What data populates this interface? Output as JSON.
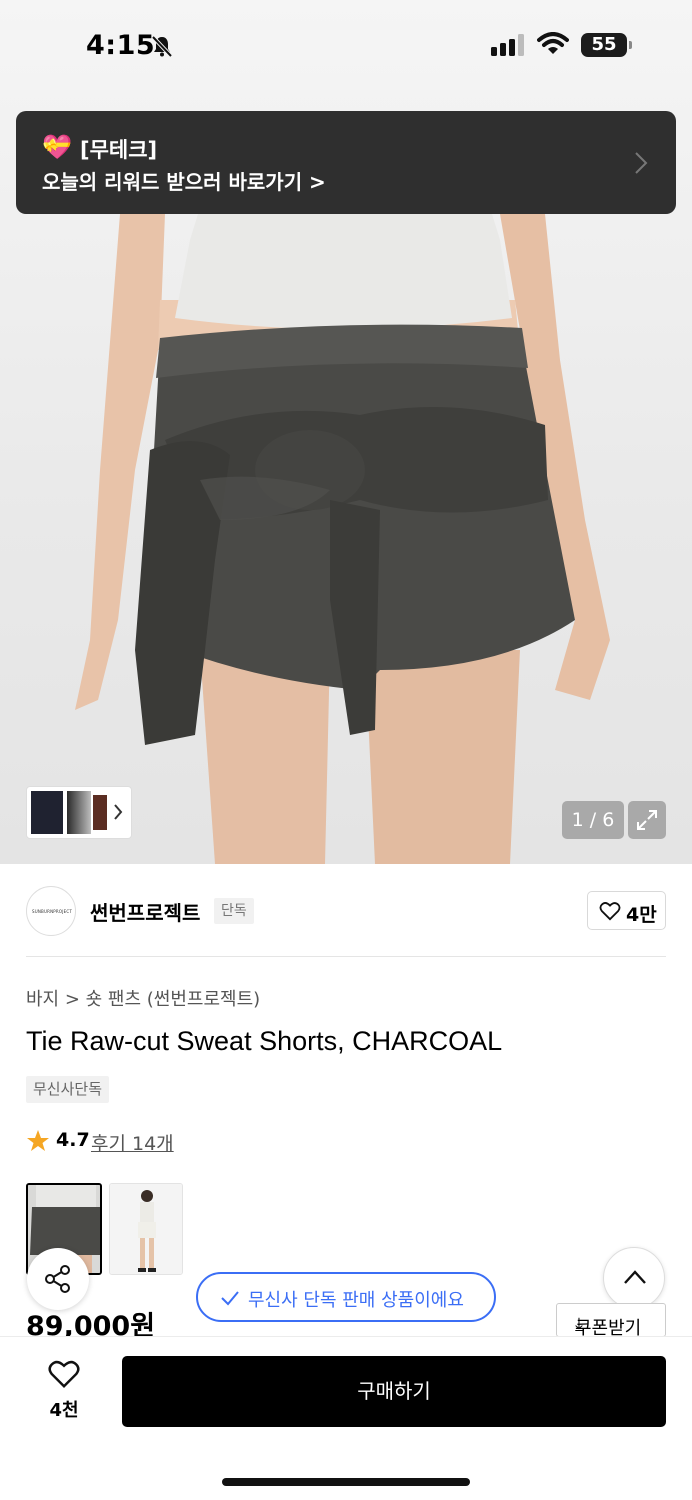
{
  "status_bar": {
    "time": "4:15",
    "battery": "55"
  },
  "banner": {
    "gift_emoji": "💝",
    "tag": "[무테크]",
    "message": "오늘의 리워드 받으러 바로가기 >"
  },
  "gallery": {
    "page_indicator": "1 / 6"
  },
  "brand": {
    "logo_text": "SUNBURNPROJECT",
    "name": "썬번프로젝트",
    "badge": "단독",
    "likes": "4만"
  },
  "product": {
    "breadcrumb": "바지 > 숏 팬츠 (썬번프로젝트)",
    "title": "Tie Raw-cut Sweat Shorts, CHARCOAL",
    "exclusive_badge": "무신사단독",
    "rating": "4.7",
    "reviews": "후기 14개",
    "price": "89,000원"
  },
  "notice": {
    "text": "무신사 단독 판매 상품이에요"
  },
  "coupon": {
    "label": "쿠폰받기"
  },
  "bottom_bar": {
    "heart_count": "4천",
    "buy_label": "구매하기"
  },
  "colors": {
    "accent_blue": "#3b6ef5",
    "star": "#f5a623",
    "banner_bg": "#2f2f2f",
    "button_bg": "#000000"
  }
}
